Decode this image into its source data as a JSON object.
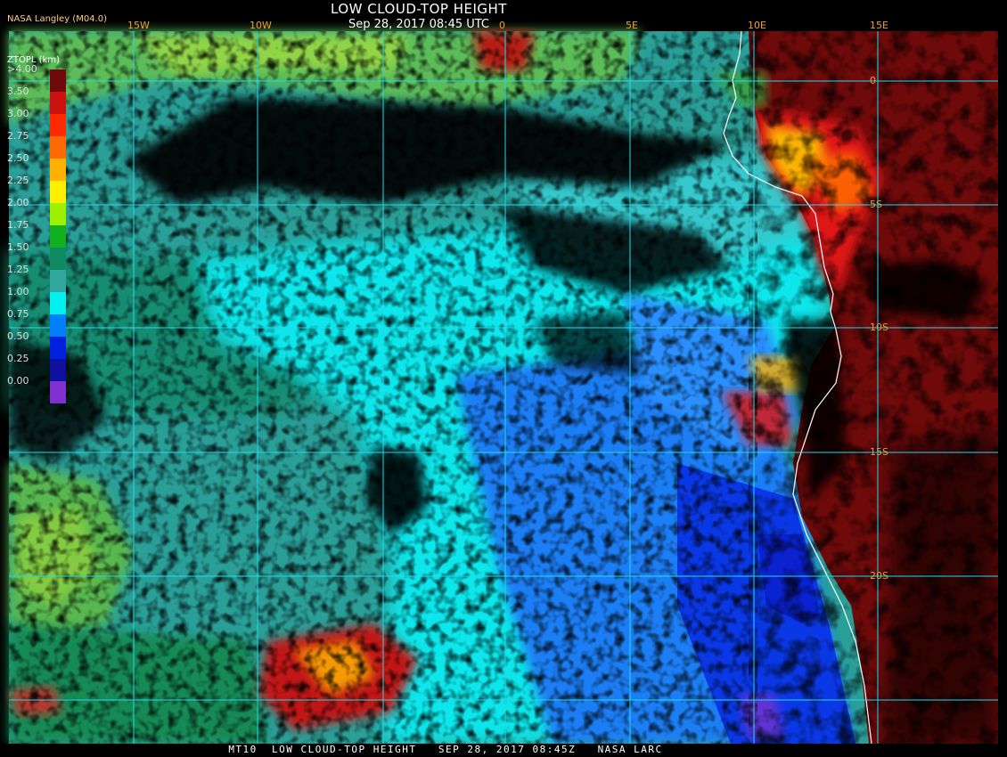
{
  "header": {
    "org_label": "NASA Langley (M04.0)",
    "title": "LOW CLOUD-TOP HEIGHT",
    "subtitle": "Sep 28, 2017 08:45 UTC"
  },
  "footer": {
    "text": "MT10  LOW CLOUD-TOP HEIGHT   SEP 28, 2017 08:45Z   NASA LARC"
  },
  "map": {
    "longitude_labels": [
      "15W",
      "10W",
      "0",
      "5E",
      "10E",
      "15E"
    ],
    "latitude_labels": [
      "0",
      "5S",
      "10S",
      "15S",
      "20S"
    ],
    "grid_color": "#22d8e8",
    "coastline_color": "#ffffff"
  },
  "legend": {
    "title": "ZTOPL (km)",
    "items": [
      {
        "label": ">4.00",
        "color": "#6e0a0a"
      },
      {
        "label": "3.50",
        "color": "#cc1010"
      },
      {
        "label": "3.00",
        "color": "#ff2a00"
      },
      {
        "label": "2.75",
        "color": "#ff6a00"
      },
      {
        "label": "2.50",
        "color": "#ffb000"
      },
      {
        "label": "2.25",
        "color": "#fff000"
      },
      {
        "label": "2.00",
        "color": "#9cf000"
      },
      {
        "label": "1.75",
        "color": "#10b020"
      },
      {
        "label": "1.50",
        "color": "#108a60"
      },
      {
        "label": "1.25",
        "color": "#30a8a0"
      },
      {
        "label": "1.00",
        "color": "#00f0f0"
      },
      {
        "label": "0.75",
        "color": "#0080ff"
      },
      {
        "label": "0.50",
        "color": "#0020e0"
      },
      {
        "label": "0.25",
        "color": "#1010a0"
      },
      {
        "label": "0.00",
        "color": "#8030d0"
      }
    ]
  }
}
